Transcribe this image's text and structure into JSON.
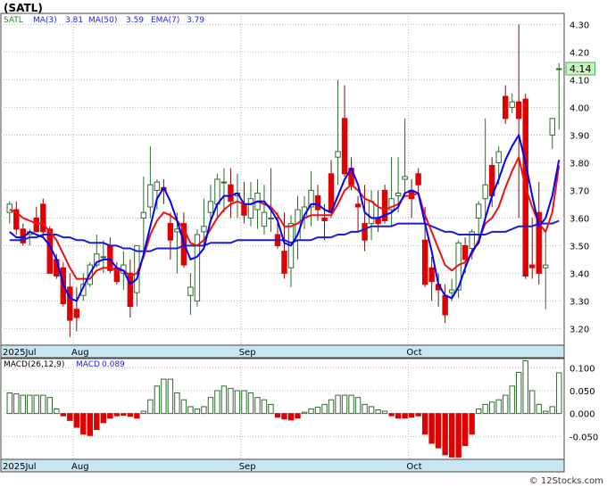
{
  "chart_data": [
    {
      "type": "candlestick",
      "title": "(SATL)",
      "legend": [
        {
          "label": "SATL",
          "color": "#2e7d32"
        },
        {
          "label": "MA(3)",
          "value": "3.81",
          "color": "#1a1aff"
        },
        {
          "label": "MA(50)",
          "value": "3.59",
          "color": "#1a1aff"
        },
        {
          "label": "EMA(7)",
          "value": "3.79",
          "color": "#1a1aff"
        }
      ],
      "last_price": "4.14",
      "y_ticks": [
        "3.20",
        "3.30",
        "3.40",
        "3.50",
        "3.60",
        "3.70",
        "3.80",
        "3.90",
        "4.00",
        "4.10",
        "4.20",
        "4.30"
      ],
      "ylim": [
        3.14,
        4.34
      ],
      "x_labels": [
        {
          "label": "2025Jul",
          "index": 0
        },
        {
          "label": "Aug",
          "index": 10
        },
        {
          "label": "Sep",
          "index": 35
        },
        {
          "label": "Oct",
          "index": 60
        }
      ],
      "grid": true,
      "colors": {
        "up": "#ffffff",
        "up_border": "#2e6b2e",
        "down": "#e00000",
        "ma3": "#0000ff",
        "ma50": "#1c1cd6",
        "ema7": "#ee1111",
        "axis_band": "#c8e6f2"
      },
      "candles": [
        [
          3.62,
          3.66,
          3.58,
          3.65
        ],
        [
          3.63,
          3.66,
          3.54,
          3.56
        ],
        [
          3.56,
          3.58,
          3.5,
          3.51
        ],
        [
          3.54,
          3.56,
          3.5,
          3.55
        ],
        [
          3.6,
          3.64,
          3.55,
          3.55
        ],
        [
          3.65,
          3.67,
          3.53,
          3.55
        ],
        [
          3.56,
          3.57,
          3.4,
          3.4
        ],
        [
          3.45,
          3.47,
          3.38,
          3.39
        ],
        [
          3.42,
          3.44,
          3.28,
          3.29
        ],
        [
          3.35,
          3.4,
          3.17,
          3.23
        ],
        [
          3.27,
          3.35,
          3.19,
          3.24
        ],
        [
          3.32,
          3.4,
          3.3,
          3.36
        ],
        [
          3.36,
          3.44,
          3.35,
          3.43
        ],
        [
          3.43,
          3.54,
          3.42,
          3.47
        ],
        [
          3.46,
          3.52,
          3.4,
          3.46
        ],
        [
          3.5,
          3.53,
          3.4,
          3.41
        ],
        [
          3.42,
          3.44,
          3.36,
          3.37
        ],
        [
          3.4,
          3.48,
          3.34,
          3.43
        ],
        [
          3.4,
          3.45,
          3.24,
          3.28
        ],
        [
          3.33,
          3.5,
          3.28,
          3.5
        ],
        [
          3.6,
          3.75,
          3.48,
          3.62
        ],
        [
          3.64,
          3.86,
          3.6,
          3.72
        ],
        [
          3.7,
          3.74,
          3.63,
          3.73
        ],
        [
          3.71,
          3.74,
          3.65,
          3.7
        ],
        [
          3.58,
          3.62,
          3.45,
          3.52
        ],
        [
          3.55,
          3.62,
          3.4,
          3.56
        ],
        [
          3.58,
          3.62,
          3.42,
          3.43
        ],
        [
          3.32,
          3.4,
          3.25,
          3.35
        ],
        [
          3.3,
          3.56,
          3.28,
          3.54
        ],
        [
          3.55,
          3.67,
          3.49,
          3.57
        ],
        [
          3.62,
          3.72,
          3.59,
          3.66
        ],
        [
          3.65,
          3.76,
          3.6,
          3.74
        ],
        [
          3.73,
          3.78,
          3.62,
          3.73
        ],
        [
          3.72,
          3.78,
          3.6,
          3.66
        ],
        [
          3.68,
          3.76,
          3.6,
          3.69
        ],
        [
          3.65,
          3.73,
          3.58,
          3.61
        ],
        [
          3.6,
          3.73,
          3.57,
          3.67
        ],
        [
          3.63,
          3.74,
          3.56,
          3.69
        ],
        [
          3.57,
          3.72,
          3.54,
          3.62
        ],
        [
          3.6,
          3.78,
          3.55,
          3.6
        ],
        [
          3.54,
          3.62,
          3.49,
          3.5
        ],
        [
          3.48,
          3.62,
          3.38,
          3.4
        ],
        [
          3.42,
          3.61,
          3.35,
          3.58
        ],
        [
          3.52,
          3.68,
          3.45,
          3.63
        ],
        [
          3.6,
          3.68,
          3.56,
          3.64
        ],
        [
          3.64,
          3.77,
          3.57,
          3.7
        ],
        [
          3.68,
          3.72,
          3.59,
          3.63
        ],
        [
          3.6,
          3.65,
          3.52,
          3.59
        ],
        [
          3.76,
          3.81,
          3.6,
          3.62
        ],
        [
          3.82,
          4.1,
          3.72,
          3.84
        ],
        [
          3.96,
          4.08,
          3.75,
          3.76
        ],
        [
          3.78,
          3.82,
          3.7,
          3.72
        ],
        [
          3.65,
          3.68,
          3.55,
          3.64
        ],
        [
          3.58,
          3.72,
          3.48,
          3.52
        ],
        [
          3.58,
          3.7,
          3.52,
          3.66
        ],
        [
          3.6,
          3.7,
          3.55,
          3.58
        ],
        [
          3.7,
          3.72,
          3.58,
          3.59
        ],
        [
          3.63,
          3.82,
          3.57,
          3.67
        ],
        [
          3.68,
          3.82,
          3.62,
          3.69
        ],
        [
          3.74,
          3.96,
          3.68,
          3.75
        ],
        [
          3.7,
          3.74,
          3.6,
          3.67
        ],
        [
          3.76,
          3.78,
          3.68,
          3.72
        ],
        [
          3.52,
          3.64,
          3.35,
          3.36
        ],
        [
          3.42,
          3.46,
          3.3,
          3.37
        ],
        [
          3.36,
          3.4,
          3.28,
          3.34
        ],
        [
          3.32,
          3.36,
          3.22,
          3.25
        ],
        [
          3.33,
          3.38,
          3.3,
          3.34
        ],
        [
          3.34,
          3.52,
          3.31,
          3.51
        ],
        [
          3.5,
          3.53,
          3.4,
          3.45
        ],
        [
          3.49,
          3.56,
          3.45,
          3.55
        ],
        [
          3.6,
          3.66,
          3.52,
          3.65
        ],
        [
          3.67,
          3.96,
          3.6,
          3.72
        ],
        [
          3.79,
          3.82,
          3.64,
          3.68
        ],
        [
          3.8,
          3.86,
          3.72,
          3.84
        ],
        [
          4.04,
          4.08,
          3.94,
          3.96
        ],
        [
          4.0,
          4.05,
          3.98,
          4.02
        ],
        [
          4.02,
          4.3,
          3.6,
          3.96
        ],
        [
          4.03,
          4.05,
          3.38,
          3.39
        ],
        [
          3.43,
          3.6,
          3.38,
          3.42
        ],
        [
          3.62,
          3.73,
          3.36,
          3.4
        ],
        [
          3.42,
          3.55,
          3.27,
          3.43
        ],
        [
          3.9,
          3.94,
          3.85,
          3.96
        ],
        [
          4.14,
          4.16,
          3.92,
          4.14
        ]
      ],
      "ma3": [
        3.55,
        3.53,
        3.53,
        3.55,
        3.54,
        3.53,
        3.5,
        3.45,
        3.36,
        3.31,
        3.3,
        3.35,
        3.4,
        3.44,
        3.45,
        3.45,
        3.42,
        3.41,
        3.36,
        3.38,
        3.47,
        3.57,
        3.67,
        3.71,
        3.66,
        3.59,
        3.51,
        3.45,
        3.46,
        3.49,
        3.59,
        3.65,
        3.68,
        3.68,
        3.69,
        3.65,
        3.65,
        3.66,
        3.66,
        3.63,
        3.59,
        3.51,
        3.5,
        3.54,
        3.61,
        3.65,
        3.65,
        3.63,
        3.62,
        3.68,
        3.74,
        3.78,
        3.72,
        3.62,
        3.6,
        3.6,
        3.61,
        3.62,
        3.64,
        3.69,
        3.7,
        3.69,
        3.58,
        3.48,
        3.36,
        3.32,
        3.31,
        3.35,
        3.42,
        3.48,
        3.51,
        3.6,
        3.68,
        3.74,
        3.81,
        3.86,
        3.9,
        3.8,
        3.68,
        3.57,
        3.6,
        3.68,
        3.81
      ],
      "ma50": [
        3.52,
        3.52,
        3.52,
        3.53,
        3.53,
        3.54,
        3.54,
        3.54,
        3.53,
        3.53,
        3.52,
        3.52,
        3.51,
        3.51,
        3.51,
        3.5,
        3.5,
        3.49,
        3.49,
        3.48,
        3.48,
        3.48,
        3.49,
        3.49,
        3.49,
        3.49,
        3.5,
        3.5,
        3.5,
        3.5,
        3.51,
        3.51,
        3.51,
        3.51,
        3.52,
        3.52,
        3.52,
        3.52,
        3.52,
        3.52,
        3.52,
        3.52,
        3.51,
        3.52,
        3.52,
        3.52,
        3.53,
        3.53,
        3.53,
        3.54,
        3.54,
        3.55,
        3.55,
        3.56,
        3.57,
        3.57,
        3.57,
        3.57,
        3.58,
        3.58,
        3.58,
        3.58,
        3.58,
        3.57,
        3.56,
        3.55,
        3.55,
        3.54,
        3.54,
        3.54,
        3.54,
        3.54,
        3.55,
        3.55,
        3.55,
        3.56,
        3.57,
        3.57,
        3.57,
        3.58,
        3.58,
        3.58,
        3.59
      ],
      "ema7": [
        3.63,
        3.62,
        3.6,
        3.59,
        3.58,
        3.58,
        3.55,
        3.52,
        3.47,
        3.42,
        3.38,
        3.38,
        3.38,
        3.41,
        3.42,
        3.42,
        3.41,
        3.41,
        3.39,
        3.4,
        3.46,
        3.54,
        3.59,
        3.62,
        3.61,
        3.59,
        3.56,
        3.51,
        3.5,
        3.52,
        3.56,
        3.6,
        3.63,
        3.65,
        3.66,
        3.65,
        3.65,
        3.66,
        3.65,
        3.64,
        3.61,
        3.57,
        3.57,
        3.58,
        3.6,
        3.61,
        3.61,
        3.61,
        3.61,
        3.65,
        3.7,
        3.72,
        3.7,
        3.67,
        3.66,
        3.64,
        3.63,
        3.64,
        3.65,
        3.68,
        3.68,
        3.69,
        3.61,
        3.55,
        3.49,
        3.43,
        3.41,
        3.43,
        3.44,
        3.47,
        3.52,
        3.58,
        3.6,
        3.64,
        3.71,
        3.77,
        3.82,
        3.71,
        3.64,
        3.58,
        3.55,
        3.62,
        3.79
      ]
    },
    {
      "type": "bar",
      "title": "MACD(26,12,9)",
      "legend": [
        {
          "label": "MACD",
          "value": "0.089",
          "color": "#1a1aff"
        }
      ],
      "y_ticks": [
        "0.100",
        "0.050",
        "0.000",
        "-0.050"
      ],
      "ylim": [
        -0.1,
        0.12
      ],
      "values": [
        0.045,
        0.043,
        0.04,
        0.04,
        0.04,
        0.04,
        0.035,
        0.01,
        -0.005,
        -0.015,
        -0.03,
        -0.045,
        -0.048,
        -0.035,
        -0.02,
        -0.01,
        -0.005,
        -0.004,
        -0.006,
        -0.01,
        0.005,
        0.03,
        0.06,
        0.075,
        0.075,
        0.045,
        0.03,
        0.015,
        0.01,
        0.015,
        0.035,
        0.05,
        0.06,
        0.055,
        0.05,
        0.05,
        0.045,
        0.035,
        0.03,
        0.02,
        -0.008,
        -0.012,
        -0.014,
        -0.01,
        0.003,
        0.01,
        0.014,
        0.02,
        0.03,
        0.04,
        0.04,
        0.04,
        0.035,
        0.02,
        0.015,
        0.008,
        0.005,
        -0.005,
        -0.01,
        -0.01,
        -0.008,
        -0.005,
        -0.045,
        -0.065,
        -0.075,
        -0.09,
        -0.095,
        -0.095,
        -0.07,
        -0.045,
        0.01,
        0.02,
        0.025,
        0.03,
        0.04,
        0.06,
        0.09,
        0.115,
        0.05,
        0.02,
        0.005,
        0.015,
        0.089
      ]
    }
  ],
  "footer": {
    "watermark": "© 12Stocks.com"
  }
}
